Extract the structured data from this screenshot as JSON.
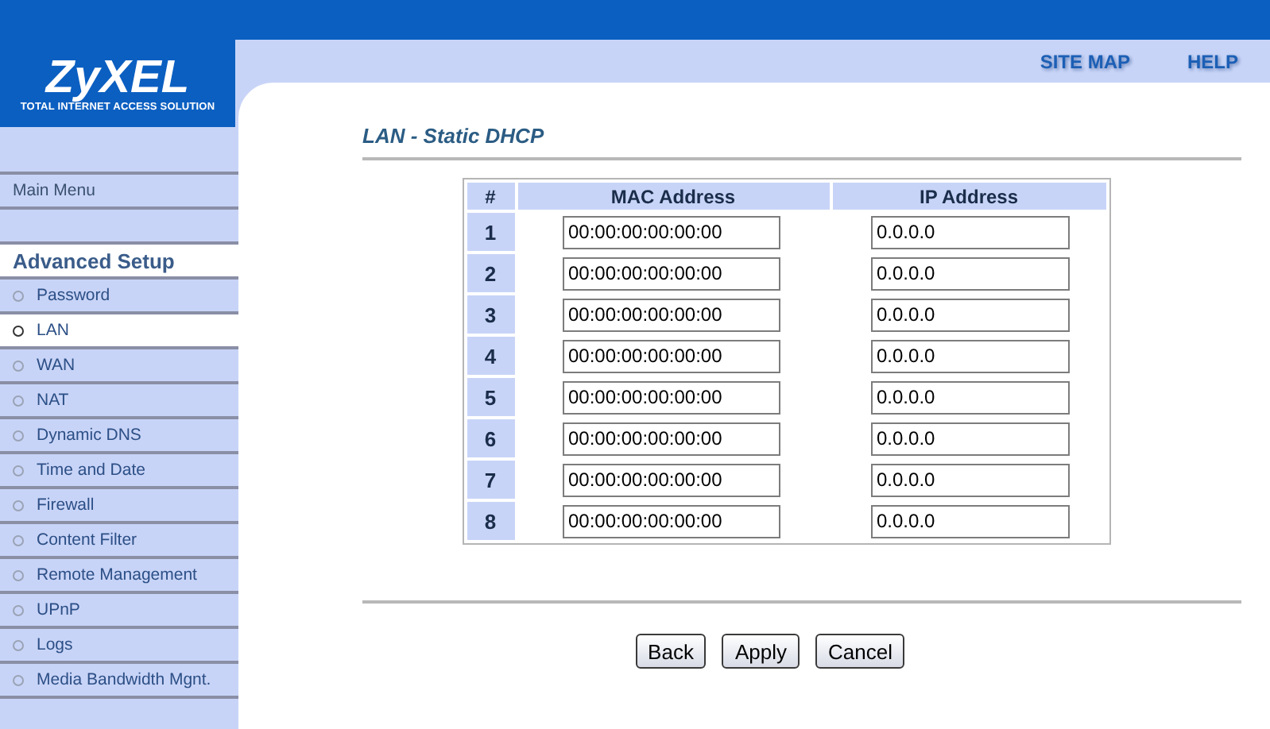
{
  "logo": {
    "name": "ZyXEL",
    "tagline": "TOTAL INTERNET ACCESS SOLUTION"
  },
  "top_links": [
    "SITE MAP",
    "HELP"
  ],
  "sidebar": {
    "items": [
      {
        "kind": "link",
        "label": "Main Menu",
        "selected": false
      },
      {
        "kind": "section",
        "label": "Advanced Setup"
      },
      {
        "kind": "item",
        "label": "Password",
        "selected": false
      },
      {
        "kind": "item",
        "label": "LAN",
        "selected": true
      },
      {
        "kind": "item",
        "label": "WAN",
        "selected": false
      },
      {
        "kind": "item",
        "label": "NAT",
        "selected": false
      },
      {
        "kind": "item",
        "label": "Dynamic DNS",
        "selected": false
      },
      {
        "kind": "item",
        "label": "Time and Date",
        "selected": false
      },
      {
        "kind": "item",
        "label": "Firewall",
        "selected": false
      },
      {
        "kind": "item",
        "label": "Content Filter",
        "selected": false
      },
      {
        "kind": "item",
        "label": "Remote Management",
        "selected": false
      },
      {
        "kind": "item",
        "label": "UPnP",
        "selected": false
      },
      {
        "kind": "item",
        "label": "Logs",
        "selected": false
      },
      {
        "kind": "item",
        "label": "Media Bandwidth Mgnt.",
        "selected": false
      }
    ]
  },
  "page_title": "LAN - Static DHCP",
  "table": {
    "columns": [
      "#",
      "MAC Address",
      "IP Address"
    ],
    "rows": [
      {
        "index": "1",
        "mac": "00:00:00:00:00:00",
        "ip": "0.0.0.0"
      },
      {
        "index": "2",
        "mac": "00:00:00:00:00:00",
        "ip": "0.0.0.0"
      },
      {
        "index": "3",
        "mac": "00:00:00:00:00:00",
        "ip": "0.0.0.0"
      },
      {
        "index": "4",
        "mac": "00:00:00:00:00:00",
        "ip": "0.0.0.0"
      },
      {
        "index": "5",
        "mac": "00:00:00:00:00:00",
        "ip": "0.0.0.0"
      },
      {
        "index": "6",
        "mac": "00:00:00:00:00:00",
        "ip": "0.0.0.0"
      },
      {
        "index": "7",
        "mac": "00:00:00:00:00:00",
        "ip": "0.0.0.0"
      },
      {
        "index": "8",
        "mac": "00:00:00:00:00:00",
        "ip": "0.0.0.0"
      }
    ]
  },
  "buttons": [
    "Back",
    "Apply",
    "Cancel"
  ]
}
